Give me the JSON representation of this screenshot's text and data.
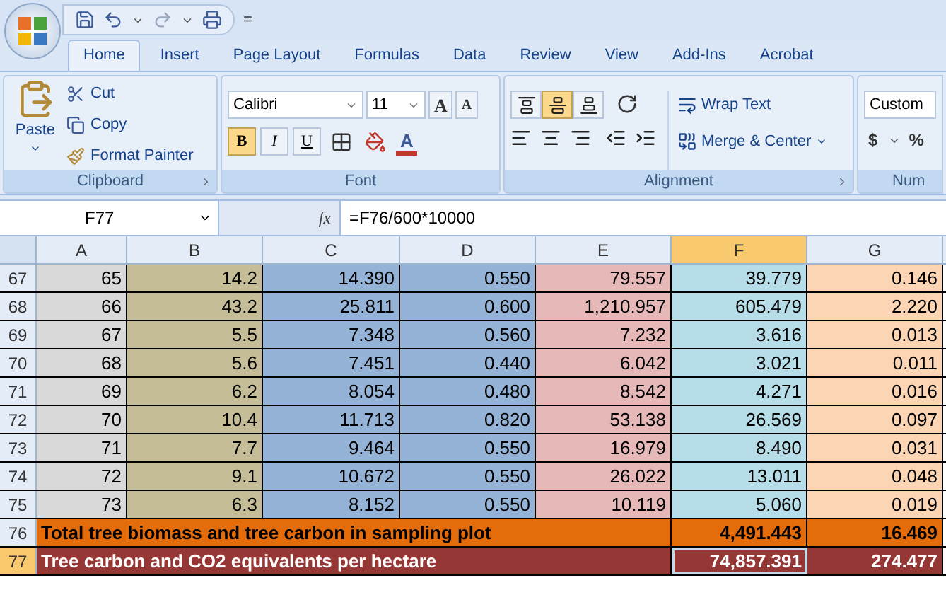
{
  "quick_access": {
    "menu_glyph": "="
  },
  "tabs": [
    {
      "label": "Home",
      "selected": true
    },
    {
      "label": "Insert",
      "selected": false
    },
    {
      "label": "Page Layout",
      "selected": false
    },
    {
      "label": "Formulas",
      "selected": false
    },
    {
      "label": "Data",
      "selected": false
    },
    {
      "label": "Review",
      "selected": false
    },
    {
      "label": "View",
      "selected": false
    },
    {
      "label": "Add-Ins",
      "selected": false
    },
    {
      "label": "Acrobat",
      "selected": false
    }
  ],
  "clipboard": {
    "label": "Clipboard",
    "paste": "Paste",
    "cut": "Cut",
    "copy": "Copy",
    "format_painter": "Format Painter"
  },
  "font": {
    "label": "Font",
    "font_name": "Calibri",
    "font_size": "11",
    "grow": "A",
    "shrink": "A",
    "bold": {
      "text": "B",
      "on": true
    },
    "italic": {
      "text": "I",
      "on": false
    },
    "underline": {
      "text": "U",
      "on": false
    },
    "font_color": "A"
  },
  "alignment": {
    "label": "Alignment",
    "vertical": [
      {
        "kind": "top",
        "on": false
      },
      {
        "kind": "middle",
        "on": true
      },
      {
        "kind": "bottom",
        "on": false
      }
    ],
    "wrap_text": "Wrap Text",
    "merge_center": "Merge & Center"
  },
  "number": {
    "label": "Num",
    "format": "Custom",
    "currency": "$",
    "percent": "%"
  },
  "name_box": "F77",
  "formula": "=F76/600*10000",
  "fx": "fx",
  "columns": [
    {
      "label": "A",
      "selected": false
    },
    {
      "label": "B",
      "selected": false
    },
    {
      "label": "C",
      "selected": false
    },
    {
      "label": "D",
      "selected": false
    },
    {
      "label": "E",
      "selected": false
    },
    {
      "label": "F",
      "selected": true
    },
    {
      "label": "G",
      "selected": false
    }
  ],
  "rows": [
    {
      "number": "67",
      "kind": "data",
      "selected": false,
      "cells": [
        "65",
        "14.2",
        "14.390",
        "0.550",
        "79.557",
        "39.779",
        "0.146"
      ]
    },
    {
      "number": "68",
      "kind": "data",
      "selected": false,
      "cells": [
        "66",
        "43.2",
        "25.811",
        "0.600",
        "1,210.957",
        "605.479",
        "2.220"
      ]
    },
    {
      "number": "69",
      "kind": "data",
      "selected": false,
      "cells": [
        "67",
        "5.5",
        "7.348",
        "0.560",
        "7.232",
        "3.616",
        "0.013"
      ]
    },
    {
      "number": "70",
      "kind": "data",
      "selected": false,
      "cells": [
        "68",
        "5.6",
        "7.451",
        "0.440",
        "6.042",
        "3.021",
        "0.011"
      ]
    },
    {
      "number": "71",
      "kind": "data",
      "selected": false,
      "cells": [
        "69",
        "6.2",
        "8.054",
        "0.480",
        "8.542",
        "4.271",
        "0.016"
      ]
    },
    {
      "number": "72",
      "kind": "data",
      "selected": false,
      "cells": [
        "70",
        "10.4",
        "11.713",
        "0.820",
        "53.138",
        "26.569",
        "0.097"
      ]
    },
    {
      "number": "73",
      "kind": "data",
      "selected": false,
      "cells": [
        "71",
        "7.7",
        "9.464",
        "0.550",
        "16.979",
        "8.490",
        "0.031"
      ]
    },
    {
      "number": "74",
      "kind": "data",
      "selected": false,
      "cells": [
        "72",
        "9.1",
        "10.672",
        "0.550",
        "26.022",
        "13.011",
        "0.048"
      ]
    },
    {
      "number": "75",
      "kind": "data",
      "selected": false,
      "cells": [
        "73",
        "6.3",
        "8.152",
        "0.550",
        "10.119",
        "5.060",
        "0.019"
      ]
    },
    {
      "number": "76",
      "kind": "total",
      "color": "#e46c0a",
      "selected": false,
      "label": "Total tree biomass and tree carbon in sampling plot",
      "f": "4,491.443",
      "g": "16.469",
      "active_cell": false
    },
    {
      "number": "77",
      "kind": "total",
      "color": "#953735",
      "selected": true,
      "label": "Tree carbon and CO2 equivalents per hectare",
      "f": "74,857.391",
      "g": "274.477",
      "active_cell": true
    }
  ]
}
